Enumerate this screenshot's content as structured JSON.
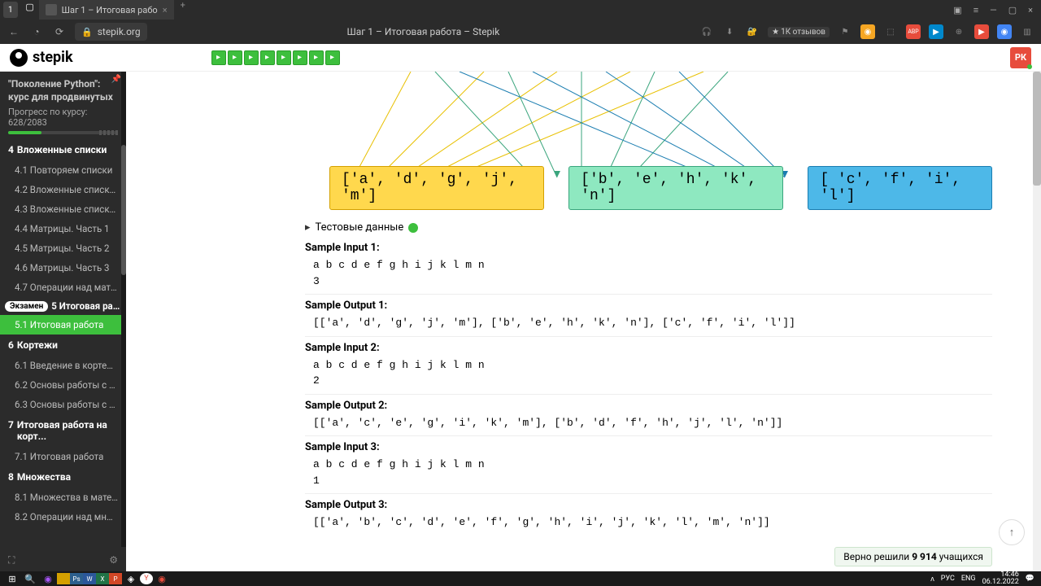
{
  "titlebar": {
    "tab_count": "1",
    "tab_title": "Шаг 1 – Итоговая рабо",
    "page_title_center": "Шаг 1 – Итоговая работа – Stepik"
  },
  "addressbar": {
    "url": "stepik.org",
    "reviews": "1К отзывов"
  },
  "stepik": {
    "logo_text": "stepik",
    "user_initials": "РК"
  },
  "sidebar": {
    "course_title": "\"Поколение Python\": курс для продвинутых",
    "progress_label": "Прогресс по курсу:",
    "progress_value": "628/2083",
    "sections": [
      {
        "num": "4",
        "title": "Вложенные списки",
        "items": [
          {
            "num": "4.1",
            "label": "Повторяем списки"
          },
          {
            "num": "4.2",
            "label": "Вложенные списки. Ча..."
          },
          {
            "num": "4.3",
            "label": "Вложенные списки. Ча..."
          },
          {
            "num": "4.4",
            "label": "Матрицы. Часть 1"
          },
          {
            "num": "4.5",
            "label": "Матрицы. Часть 2"
          },
          {
            "num": "4.6",
            "label": "Матрицы. Часть 3"
          },
          {
            "num": "4.7",
            "label": "Операции над матрица..."
          }
        ]
      },
      {
        "exam_badge": "Экзамен",
        "num": "5",
        "title": "Итоговая работа...",
        "items": [
          {
            "num": "5.1",
            "label": "Итоговая работа",
            "active": true
          }
        ]
      },
      {
        "num": "6",
        "title": "Кортежи",
        "items": [
          {
            "num": "6.1",
            "label": "Введение в кортежи"
          },
          {
            "num": "6.2",
            "label": "Основы работы с корт..."
          },
          {
            "num": "6.3",
            "label": "Основы работы с корт..."
          }
        ]
      },
      {
        "num": "7",
        "title": "Итоговая работа на корт...",
        "items": [
          {
            "num": "7.1",
            "label": "Итоговая работа"
          }
        ]
      },
      {
        "num": "8",
        "title": "Множества",
        "items": [
          {
            "num": "8.1",
            "label": "Множества в математ..."
          },
          {
            "num": "8.2",
            "label": "Операции над множес..."
          }
        ]
      }
    ]
  },
  "content": {
    "box_yellow": "['a', 'd', 'g', 'j', 'm']",
    "box_green": "['b', 'e', 'h', 'k', 'n']",
    "box_blue": "[ 'c', 'f', 'i', 'l']",
    "test_data_label": "Тестовые данные",
    "samples": [
      {
        "label": "Sample Input 1:",
        "code": "a b c d e f g h i j k l m n\n3"
      },
      {
        "label": "Sample Output 1:",
        "code": "[['a', 'd', 'g', 'j', 'm'], ['b', 'e', 'h', 'k', 'n'], ['c', 'f', 'i', 'l']]"
      },
      {
        "label": "Sample Input 2:",
        "code": "a b c d e f g h i j k l m n\n2"
      },
      {
        "label": "Sample Output 2:",
        "code": "[['a', 'c', 'e', 'g', 'i', 'k', 'm'], ['b', 'd', 'f', 'h', 'j', 'l', 'n']]"
      },
      {
        "label": "Sample Input 3:",
        "code": "a b c d e f g h i j k l m n\n1"
      },
      {
        "label": "Sample Output 3:",
        "code": "[['a', 'b', 'c', 'd', 'e', 'f', 'g', 'h', 'i', 'j', 'k', 'l', 'm', 'n']]"
      }
    ],
    "solve_text_pre": "Верно решили ",
    "solve_count": "9 914",
    "solve_text_post": " учащихся"
  },
  "tray": {
    "lang1": "РУС",
    "lang2": "ENG",
    "time": "14:46",
    "date": "06.12.2022"
  }
}
